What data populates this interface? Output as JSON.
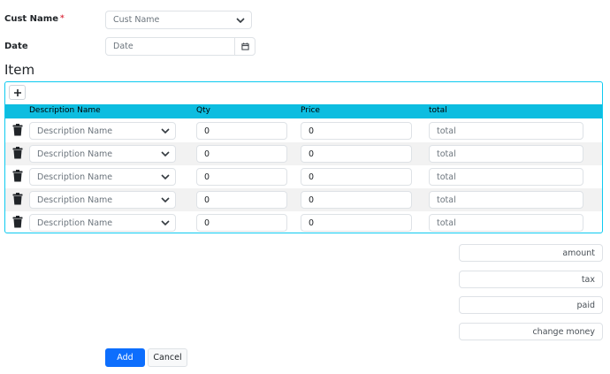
{
  "form": {
    "cust_name_label": "Cust Name",
    "required_mark": "*",
    "cust_name_placeholder": "Cust Name",
    "date_label": "Date",
    "date_placeholder": "Date"
  },
  "items": {
    "title": "Item",
    "add_row_symbol": "+",
    "columns": [
      "Description Name",
      "Qty",
      "Price",
      "total"
    ],
    "rows": [
      {
        "description": "Description Name",
        "qty": "0",
        "price": "0",
        "total": "total"
      },
      {
        "description": "Description Name",
        "qty": "0",
        "price": "0",
        "total": "total"
      },
      {
        "description": "Description Name",
        "qty": "0",
        "price": "0",
        "total": "total"
      },
      {
        "description": "Description Name",
        "qty": "0",
        "price": "0",
        "total": "total"
      },
      {
        "description": "Description Name",
        "qty": "0",
        "price": "0",
        "total": "total"
      }
    ]
  },
  "summary": {
    "amount": "amount",
    "tax": "tax",
    "paid": "paid",
    "change_money": "change money"
  },
  "actions": {
    "add_label": "Add",
    "cancel_label": "Cancel"
  },
  "icons": {
    "add": "plus-icon",
    "delete": "trash-icon",
    "dropdown": "chevron-down-icon",
    "calendar": "calendar-icon"
  },
  "colors": {
    "table_header": "#0dbde0",
    "panel_border": "#0dcaf0",
    "primary": "#0d6efd",
    "required": "#dc3545"
  }
}
